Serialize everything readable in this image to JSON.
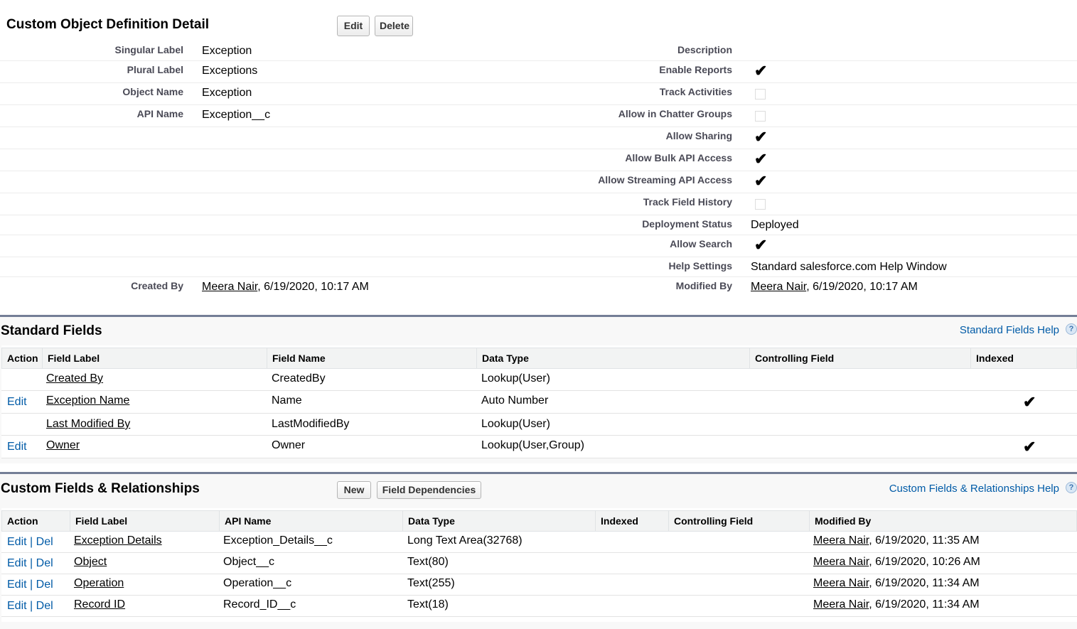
{
  "detail": {
    "title": "Custom Object Definition Detail",
    "edit_label": "Edit",
    "delete_label": "Delete",
    "left_fields": [
      {
        "label": "Singular Label",
        "value": "Exception"
      },
      {
        "label": "Plural Label",
        "value": "Exceptions"
      },
      {
        "label": "Object Name",
        "value": "Exception"
      },
      {
        "label": "API Name",
        "value": "Exception__c"
      }
    ],
    "right_fields": [
      {
        "label": "Description",
        "value": ""
      },
      {
        "label": "Enable Reports",
        "checked": true
      },
      {
        "label": "Track Activities",
        "checked": false
      },
      {
        "label": "Allow in Chatter Groups",
        "checked": false
      },
      {
        "label": "Allow Sharing",
        "checked": true
      },
      {
        "label": "Allow Bulk API Access",
        "checked": true
      },
      {
        "label": "Allow Streaming API Access",
        "checked": true
      },
      {
        "label": "Track Field History",
        "checked": false
      },
      {
        "label": "Deployment Status",
        "value": "Deployed"
      },
      {
        "label": "Allow Search",
        "checked": true
      },
      {
        "label": "Help Settings",
        "value": "Standard salesforce.com Help Window"
      }
    ],
    "created_by": {
      "label": "Created By",
      "user": "Meera Nair",
      "date": ", 6/19/2020, 10:17 AM"
    },
    "modified_by": {
      "label": "Modified By",
      "user": "Meera Nair",
      "date": ", 6/19/2020, 10:17 AM"
    }
  },
  "standard_fields": {
    "title": "Standard Fields",
    "help": "Standard Fields Help",
    "headers": [
      "Action",
      "Field Label",
      "Field Name",
      "Data Type",
      "Controlling Field",
      "Indexed"
    ],
    "rows": [
      {
        "action": "",
        "label": "Created By",
        "name": "CreatedBy",
        "type": "Lookup(User)",
        "indexed": false
      },
      {
        "action": "Edit",
        "label": "Exception Name",
        "name": "Name",
        "type": "Auto Number",
        "indexed": true
      },
      {
        "action": "",
        "label": "Last Modified By",
        "name": "LastModifiedBy",
        "type": "Lookup(User)",
        "indexed": false
      },
      {
        "action": "Edit",
        "label": "Owner",
        "name": "Owner",
        "type": "Lookup(User,Group)",
        "indexed": true
      }
    ]
  },
  "custom_fields": {
    "title": "Custom Fields & Relationships",
    "new_label": "New",
    "deps_label": "Field Dependencies",
    "help": "Custom Fields & Relationships Help",
    "headers": [
      "Action",
      "Field Label",
      "API Name",
      "Data Type",
      "Indexed",
      "Controlling Field",
      "Modified By"
    ],
    "edit": "Edit",
    "del": "Del",
    "pipe": "|",
    "rows": [
      {
        "label": "Exception Details",
        "api": "Exception_Details__c",
        "type": "Long Text Area(32768)",
        "user": "Meera Nair",
        "date": ", 6/19/2020, 11:35 AM"
      },
      {
        "label": "Object",
        "api": "Object__c",
        "type": "Text(80)",
        "user": "Meera Nair",
        "date": ", 6/19/2020, 10:26 AM"
      },
      {
        "label": "Operation",
        "api": "Operation__c",
        "type": "Text(255)",
        "user": "Meera Nair",
        "date": ", 6/19/2020, 11:34 AM"
      },
      {
        "label": "Record ID",
        "api": "Record_ID__c",
        "type": "Text(18)",
        "user": "Meera Nair",
        "date": ", 6/19/2020, 11:34 AM"
      }
    ]
  },
  "icons": {
    "check": "✔",
    "help": "?"
  }
}
